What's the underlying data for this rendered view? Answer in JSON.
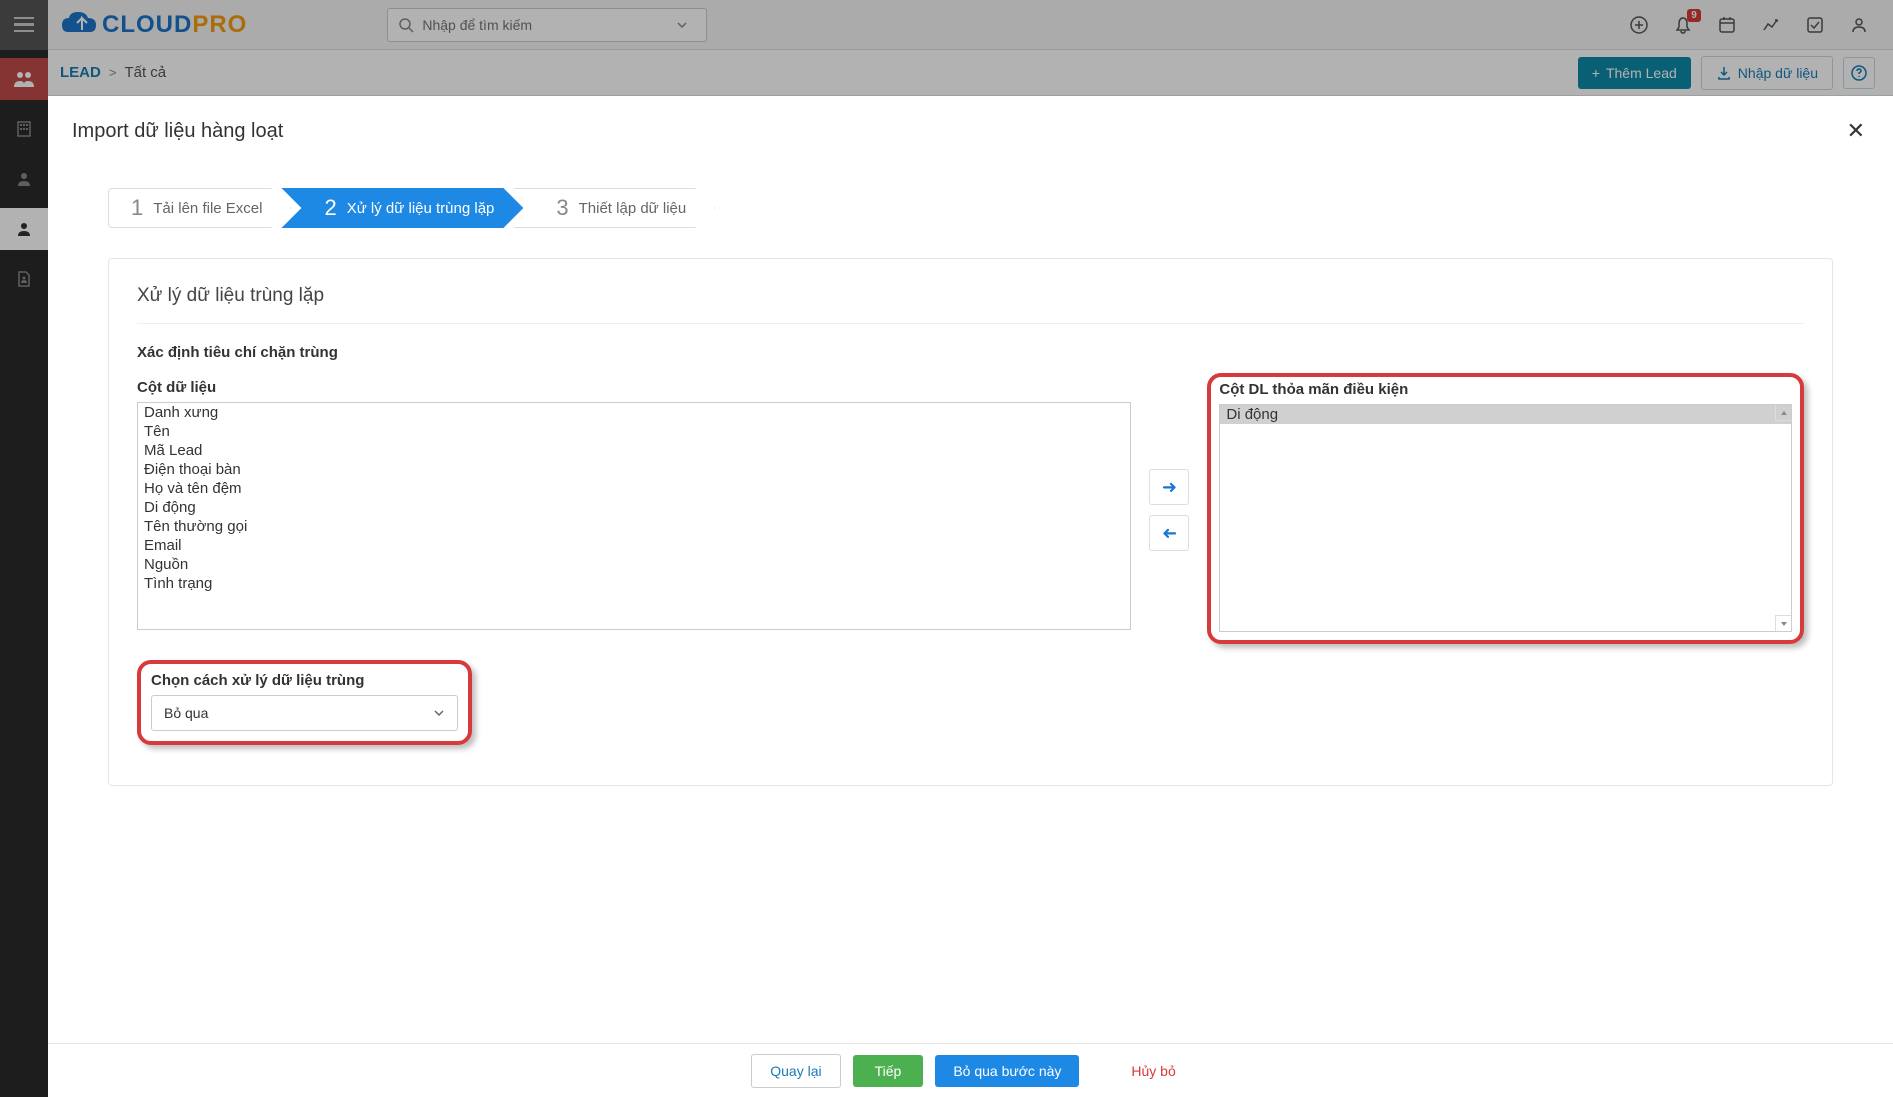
{
  "header": {
    "search_placeholder": "Nhập để tìm kiếm",
    "notification_count": "9"
  },
  "breadcrumb": {
    "module": "LEAD",
    "separator": ">",
    "filter": "Tất cả"
  },
  "sub_header_buttons": {
    "add_lead": "Thêm Lead",
    "import_data": "Nhập dữ liệu"
  },
  "modal": {
    "title": "Import dữ liệu hàng loạt"
  },
  "wizard": {
    "step1_num": "1",
    "step1_label": "Tải lên file Excel",
    "step2_num": "2",
    "step2_label": "Xử lý dữ liệu trùng lặp",
    "step3_num": "3",
    "step3_label": "Thiết lập dữ liệu"
  },
  "panel": {
    "title": "Xử lý dữ liệu trùng lặp",
    "criteria_label": "Xác định tiêu chí chặn trùng",
    "col_data_label": "Cột dữ liệu",
    "col_condition_label": "Cột DL thỏa mãn điều kiện",
    "available_fields": [
      "Danh xưng",
      "Tên",
      "Mã Lead",
      "Điện thoại bàn",
      "Họ và tên đệm",
      "Di động",
      "Tên thường gọi",
      "Email",
      "Nguồn",
      "Tình trạng"
    ],
    "selected_fields": [
      "Di động"
    ],
    "duplicate_handling_label": "Chọn cách xử lý dữ liệu trùng",
    "duplicate_handling_value": "Bỏ qua"
  },
  "footer": {
    "back": "Quay lại",
    "next": "Tiếp",
    "skip": "Bỏ qua bước này",
    "cancel": "Hủy bỏ"
  }
}
